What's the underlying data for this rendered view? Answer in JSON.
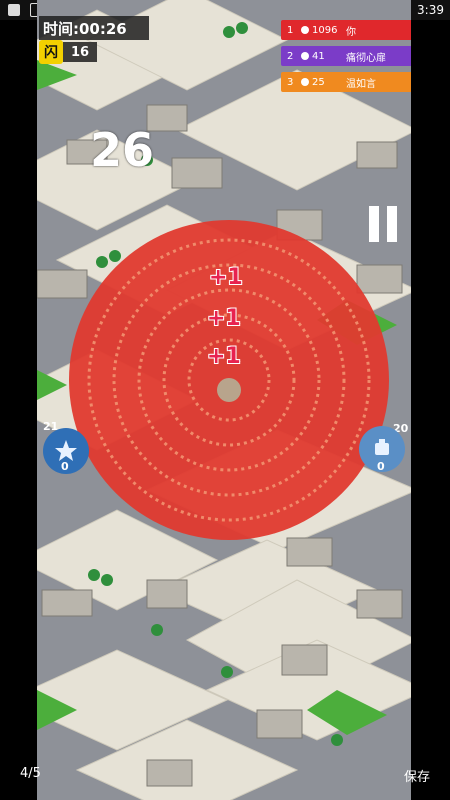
{
  "status": {
    "time": "3:39"
  },
  "hud": {
    "timer_label": "时间:00:26",
    "logo_char": "闪",
    "my_count": "16",
    "countdown": "26"
  },
  "leaderboard": [
    {
      "rank": "1",
      "score": "1096",
      "name": "你",
      "color": "#e0282c"
    },
    {
      "rank": "2",
      "score": "41",
      "name": "痛彻心扉",
      "color": "#7b3cc8"
    },
    {
      "rank": "3",
      "score": "25",
      "name": "温如言",
      "color": "#f08a1f"
    }
  ],
  "popups": [
    "+1",
    "+1",
    "+1"
  ],
  "rivals": {
    "left": {
      "top_num": "21",
      "bottom_num": "0",
      "icon": "star-shield-icon"
    },
    "right": {
      "top_num": "20",
      "bottom_num": "0",
      "icon": "robot-icon"
    }
  },
  "viewer": {
    "page": "4/5",
    "save_label": "保存"
  },
  "colors": {
    "crowd": "#e03a2f",
    "road": "#8e9198",
    "block": "#e6e2d6"
  }
}
